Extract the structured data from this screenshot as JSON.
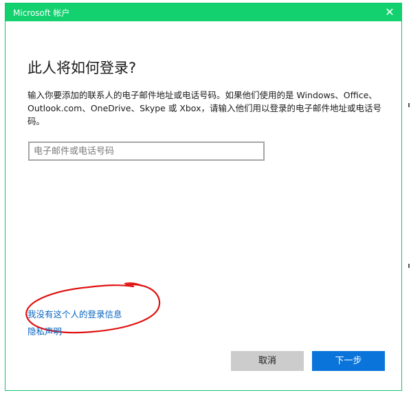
{
  "window": {
    "title": "Microsoft 帐户",
    "close_glyph": "✕"
  },
  "main": {
    "heading": "此人将如何登录?",
    "description": "输入你要添加的联系人的电子邮件地址或电话号码。如果他们使用的是 Windows、Office、Outlook.com、OneDrive、Skype 或 Xbox，请输入他们用以登录的电子邮件地址或电话号码。",
    "email_input": {
      "value": "",
      "placeholder": "电子邮件或电话号码"
    }
  },
  "links": {
    "no_signin_info": "我没有这个人的登录信息",
    "privacy": "隐私声明"
  },
  "buttons": {
    "cancel": "取消",
    "next": "下一步"
  },
  "colors": {
    "titlebar": "#13d16f",
    "primary_button": "#0a74da",
    "link": "#0a65c2",
    "annotation": "#e01010"
  }
}
